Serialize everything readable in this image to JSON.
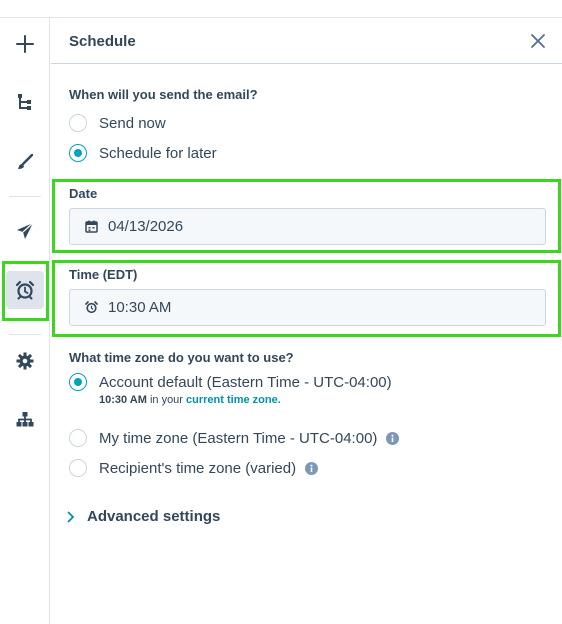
{
  "rail": {
    "items": [
      {
        "name": "add",
        "icon": "plus-icon"
      },
      {
        "name": "branch",
        "icon": "branch-icon"
      },
      {
        "name": "design",
        "icon": "brush-icon"
      },
      {
        "name": "send",
        "icon": "paper-plane-icon"
      },
      {
        "name": "schedule",
        "icon": "alarm-clock-icon",
        "active": true
      },
      {
        "name": "settings",
        "icon": "gear-icon"
      },
      {
        "name": "structure",
        "icon": "sitemap-icon"
      }
    ]
  },
  "panel": {
    "title": "Schedule",
    "send_question": "When will you send the email?",
    "send_options": [
      {
        "label": "Send now",
        "selected": false
      },
      {
        "label": "Schedule for later",
        "selected": true
      }
    ],
    "date": {
      "label": "Date",
      "value": "04/13/2026"
    },
    "time": {
      "label": "Time (EDT)",
      "value": "10:30 AM"
    },
    "timezone_question": "What time zone do you want to use?",
    "timezone_options": [
      {
        "label": "Account default (Eastern Time - UTC-04:00)",
        "selected": true
      },
      {
        "label": "My time zone (Eastern Time - UTC-04:00)",
        "selected": false
      },
      {
        "label": "Recipient's time zone (varied)",
        "selected": false
      }
    ],
    "timezone_note": {
      "time": "10:30 AM",
      "middle": " in your ",
      "link": "current time zone."
    },
    "advanced": "Advanced settings"
  },
  "colors": {
    "accent": "#00a4bd",
    "highlight": "#3cd61e",
    "text": "#33475b"
  }
}
